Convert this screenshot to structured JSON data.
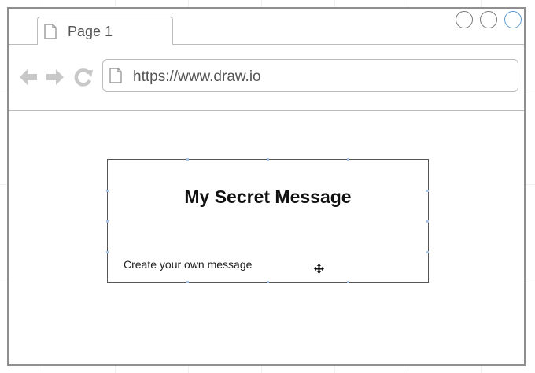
{
  "browser": {
    "tab": {
      "label": "Page 1",
      "icon": "page-icon"
    },
    "window_controls": [
      "minimize-circle-icon",
      "maximize-circle-icon",
      "close-circle-icon"
    ],
    "nav": [
      "back-arrow-icon",
      "forward-arrow-icon",
      "reload-icon"
    ],
    "address": {
      "url": "https://www.draw.io",
      "icon": "page-icon"
    },
    "accent_color": "#5b9bd5"
  },
  "content": {
    "card": {
      "title": "My Secret Message",
      "subtitle": "Create your own message"
    }
  }
}
